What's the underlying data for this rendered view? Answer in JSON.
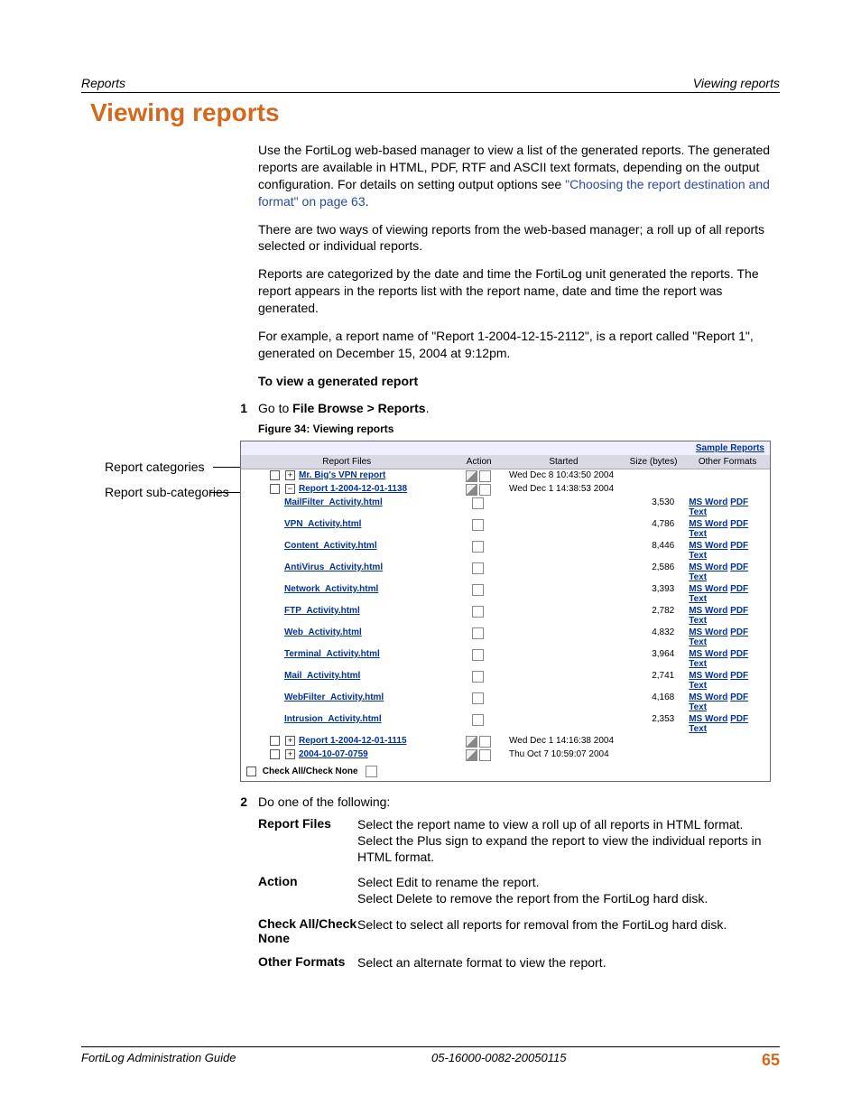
{
  "header": {
    "left": "Reports",
    "right": "Viewing reports"
  },
  "h1": "Viewing reports",
  "p1a": "Use the FortiLog web-based manager to view a list of the generated reports. The generated reports are available in HTML, PDF, RTF and ASCII text formats, depending on the output configuration. For details on setting output options see ",
  "p1link": "\"Choosing the report destination and format\" on page 63",
  "p1b": ".",
  "p2": "There are two ways of viewing reports from the web-based manager; a roll up of all reports selected or individual reports.",
  "p3": "Reports are categorized by the date and time the FortiLog unit generated the reports. The report appears in the reports list with the report name, date and time the report was generated.",
  "p4": "For example, a report name of \"Report 1-2004-12-15-2112\", is a report called \"Report 1\", generated on December 15, 2004 at 9:12pm.",
  "sub1": "To view a generated report",
  "step1_num": "1",
  "step1a": "Go to ",
  "step1b": "File Browse > Reports",
  "step1c": ".",
  "figcap": "Figure 34: Viewing reports",
  "sidelabels": {
    "a": "Report categories",
    "b": "Report sub-categories"
  },
  "ss": {
    "sample": "Sample Reports",
    "cols": {
      "files": "Report Files",
      "action": "Action",
      "started": "Started",
      "size": "Size (bytes)",
      "other": "Other Formats"
    },
    "rows": [
      {
        "type": "top",
        "exp": "+",
        "name": "Mr. Big's VPN report",
        "action": "ed",
        "started": "Wed Dec 8 10:43:50 2004",
        "size": "",
        "fmt": ""
      },
      {
        "type": "top",
        "exp": "−",
        "name": "Report 1-2004-12-01-1138",
        "action": "ed",
        "started": "Wed Dec 1 14:38:53 2004",
        "size": "",
        "fmt": ""
      },
      {
        "type": "sub",
        "name": "MailFilter_Activity.html",
        "action": "d",
        "size": "3,530",
        "fmt": "y"
      },
      {
        "type": "sub",
        "name": "VPN_Activity.html",
        "action": "d",
        "size": "4,786",
        "fmt": "y"
      },
      {
        "type": "sub",
        "name": "Content_Activity.html",
        "action": "d",
        "size": "8,446",
        "fmt": "y"
      },
      {
        "type": "sub",
        "name": "AntiVirus_Activity.html",
        "action": "d",
        "size": "2,586",
        "fmt": "y"
      },
      {
        "type": "sub",
        "name": "Network_Activity.html",
        "action": "d",
        "size": "3,393",
        "fmt": "y"
      },
      {
        "type": "sub",
        "name": "FTP_Activity.html",
        "action": "d",
        "size": "2,782",
        "fmt": "y"
      },
      {
        "type": "sub",
        "name": "Web_Activity.html",
        "action": "d",
        "size": "4,832",
        "fmt": "y"
      },
      {
        "type": "sub",
        "name": "Terminal_Activity.html",
        "action": "d",
        "size": "3,964",
        "fmt": "y"
      },
      {
        "type": "sub",
        "name": "Mail_Activity.html",
        "action": "d",
        "size": "2,741",
        "fmt": "y"
      },
      {
        "type": "sub",
        "name": "WebFilter_Activity.html",
        "action": "d",
        "size": "4,168",
        "fmt": "y"
      },
      {
        "type": "sub",
        "name": "Intrusion_Activity.html",
        "action": "d",
        "size": "2,353",
        "fmt": "y"
      },
      {
        "type": "top",
        "exp": "+",
        "name": "Report 1-2004-12-01-1115",
        "action": "ed",
        "started": "Wed Dec 1 14:16:38 2004",
        "size": "",
        "fmt": ""
      },
      {
        "type": "top",
        "exp": "+",
        "name": "2004-10-07-0759",
        "action": "ed",
        "started": "Thu Oct 7 10:59:07 2004",
        "size": "",
        "fmt": ""
      }
    ],
    "fmts": {
      "a": "MS Word",
      "b": "PDF",
      "c": "Text"
    },
    "check": "Check All/Check None"
  },
  "step2_num": "2",
  "step2": "Do one of the following:",
  "defs": [
    {
      "t": "Report Files",
      "d": "Select the report name to view a roll up of all reports in HTML format. Select the Plus sign to expand the report to view the individual reports in HTML format."
    },
    {
      "t": "Action",
      "d": "Select Edit to rename the report.\nSelect Delete to remove the report from the FortiLog hard disk."
    },
    {
      "t": "Check All/Check None",
      "d": "Select to select all reports for removal from the FortiLog hard disk."
    },
    {
      "t": "Other Formats",
      "d": "Select an alternate format to view the report."
    }
  ],
  "footer": {
    "left": "FortiLog Administration Guide",
    "center": "05-16000-0082-20050115",
    "page": "65"
  }
}
